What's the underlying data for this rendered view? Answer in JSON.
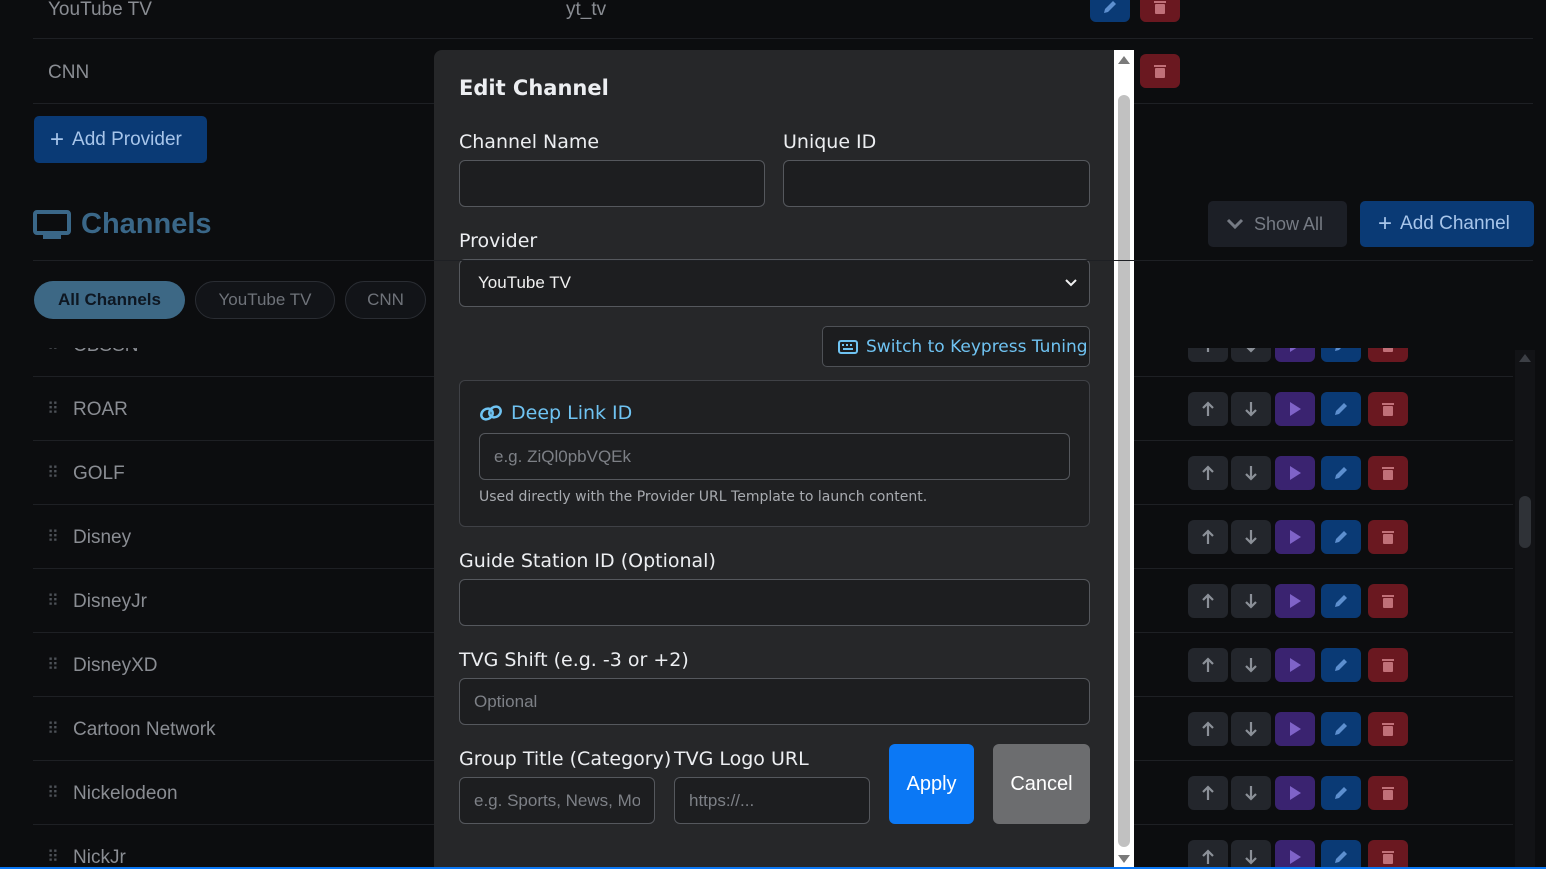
{
  "providers": [
    {
      "name": "YouTube TV",
      "id": "yt_tv"
    },
    {
      "name": "CNN",
      "id": ""
    }
  ],
  "add_provider_label": "Add Provider",
  "channels_title": "Channels",
  "show_all_label": "Show All",
  "add_channel_label": "Add Channel",
  "filters": [
    "All Channels",
    "YouTube TV",
    "CNN"
  ],
  "channel_list": [
    "CBSSN",
    "ROAR",
    "GOLF",
    "Disney",
    "DisneyJr",
    "DisneyXD",
    "Cartoon Network",
    "Nickelodeon",
    "NickJr"
  ],
  "modal": {
    "title": "Edit Channel",
    "channel_name_label": "Channel Name",
    "channel_name_value": "",
    "unique_id_label": "Unique ID",
    "unique_id_value": "",
    "provider_label": "Provider",
    "provider_selected": "YouTube TV",
    "switch_label": "Switch to Keypress Tuning",
    "deeplink_title": "Deep Link ID",
    "deeplink_placeholder": "e.g. ZiQl0pbVQEk",
    "deeplink_help": "Used directly with the Provider URL Template to launch content.",
    "guide_label": "Guide Station ID (Optional)",
    "guide_value": "",
    "tvg_shift_label": "TVG Shift (e.g. -3 or +2)",
    "tvg_shift_placeholder": "Optional",
    "group_title_label": "Group Title (Category)",
    "group_title_placeholder": "e.g. Sports, News, Movies",
    "tvg_logo_label": "TVG Logo URL",
    "tvg_logo_placeholder": "https://...",
    "apply_label": "Apply",
    "cancel_label": "Cancel"
  },
  "colors": {
    "accent": "#0b78f5",
    "link": "#6fc3f2",
    "delete": "#6a1820",
    "play": "#3a2370"
  }
}
